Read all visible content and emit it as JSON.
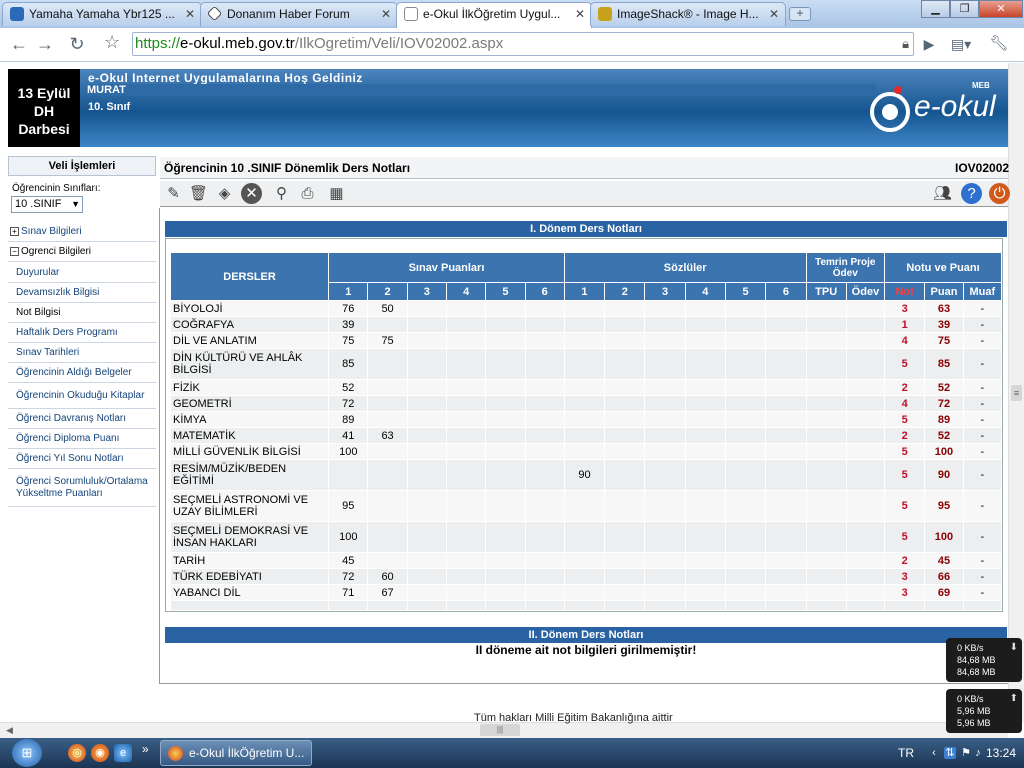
{
  "browser": {
    "tabs": [
      {
        "title": "Yamaha Yamaha Ybr125 ...",
        "icon": "page-icon"
      },
      {
        "title": "Donanım Haber Forum",
        "icon": "forum-icon"
      },
      {
        "title": "e-Okul İlkÖğretim Uygul...",
        "icon": "page-icon"
      },
      {
        "title": "ImageShack® - Image H...",
        "icon": "frog-icon"
      }
    ],
    "url_scheme": "https://",
    "url_host": "e-okul.meb.gov.tr",
    "url_path": "/IlkOgretim/Veli/IOV02002.aspx"
  },
  "header": {
    "date_box": [
      "13 Eylül",
      "DH",
      "Darbesi"
    ],
    "welcome": "e-Okul Internet Uygulamalarına Hoş Geldiniz",
    "student_name": "MURAT",
    "class_label": "10. Sınıf",
    "logo_small": "MEB",
    "logo_text": "e-okul"
  },
  "sidebar": {
    "title": "Veli İşlemleri",
    "class_select_label": "Öğrencinin Sınıfları:",
    "class_select_value": "10 .SINIF",
    "sections": [
      {
        "label": "Sınav Bilgileri",
        "expanded": false
      },
      {
        "label": "Ogrenci Bilgileri",
        "expanded": true
      }
    ],
    "items": [
      "Duyurular",
      "Devamsızlık Bilgisi",
      "Not Bilgisi",
      "Haftalık Ders Programı",
      "Sınav Tarihleri",
      "Öğrencinin Aldığı Belgeler",
      "Öğrencinin Okuduğu Kitaplar",
      "Öğrenci Davranış Notları",
      "Öğrenci Diploma Puanı",
      "Öğrenci Yıl Sonu Notları",
      "Öğrenci Sorumluluk/Ortalama Yükseltme Puanları"
    ]
  },
  "panel": {
    "title": "Öğrencinin  10 .SINIF  Dönemlik Ders Notları",
    "code": "IOV02002"
  },
  "sem1": {
    "title": "I. Dönem Ders Notları",
    "headers": {
      "dersler": "DERSLER",
      "sinav": "Sınav Puanları",
      "sozlu": "Sözlüler",
      "temrin": "Temrin Proje Ödev",
      "notu": "Notu ve Puanı",
      "tpu": "TPU",
      "odev": "Ödev",
      "not": "Not",
      "puan": "Puan",
      "muaf": "Muaf",
      "nums": [
        "1",
        "2",
        "3",
        "4",
        "5",
        "6"
      ]
    },
    "rows": [
      {
        "ders": "BİYOLOJİ",
        "s": [
          "76",
          "50",
          "",
          "",
          "",
          ""
        ],
        "z": [
          "",
          "",
          "",
          "",
          "",
          ""
        ],
        "not": "3",
        "puan": "63",
        "muaf": "-"
      },
      {
        "ders": "COĞRAFYA",
        "s": [
          "39",
          "",
          "",
          "",
          "",
          ""
        ],
        "z": [
          "",
          "",
          "",
          "",
          "",
          ""
        ],
        "not": "1",
        "puan": "39",
        "muaf": "-"
      },
      {
        "ders": "DİL VE ANLATIM",
        "s": [
          "75",
          "75",
          "",
          "",
          "",
          ""
        ],
        "z": [
          "",
          "",
          "",
          "",
          "",
          ""
        ],
        "not": "4",
        "puan": "75",
        "muaf": "-"
      },
      {
        "ders": "DİN KÜLTÜRÜ VE AHLÂK BİLGİSİ",
        "s": [
          "85",
          "",
          "",
          "",
          "",
          ""
        ],
        "z": [
          "",
          "",
          "",
          "",
          "",
          ""
        ],
        "not": "5",
        "puan": "85",
        "muaf": "-"
      },
      {
        "ders": "FİZİK",
        "s": [
          "52",
          "",
          "",
          "",
          "",
          ""
        ],
        "z": [
          "",
          "",
          "",
          "",
          "",
          ""
        ],
        "not": "2",
        "puan": "52",
        "muaf": "-"
      },
      {
        "ders": "GEOMETRİ",
        "s": [
          "72",
          "",
          "",
          "",
          "",
          ""
        ],
        "z": [
          "",
          "",
          "",
          "",
          "",
          ""
        ],
        "not": "4",
        "puan": "72",
        "muaf": "-"
      },
      {
        "ders": "KİMYA",
        "s": [
          "89",
          "",
          "",
          "",
          "",
          ""
        ],
        "z": [
          "",
          "",
          "",
          "",
          "",
          ""
        ],
        "not": "5",
        "puan": "89",
        "muaf": "-"
      },
      {
        "ders": "MATEMATİK",
        "s": [
          "41",
          "63",
          "",
          "",
          "",
          ""
        ],
        "z": [
          "",
          "",
          "",
          "",
          "",
          ""
        ],
        "not": "2",
        "puan": "52",
        "muaf": "-"
      },
      {
        "ders": "MİLLİ GÜVENLİK BİLGİSİ",
        "s": [
          "100",
          "",
          "",
          "",
          "",
          ""
        ],
        "z": [
          "",
          "",
          "",
          "",
          "",
          ""
        ],
        "not": "5",
        "puan": "100",
        "muaf": "-"
      },
      {
        "ders": "RESİM/MÜZİK/BEDEN EĞİTİMİ",
        "s": [
          "",
          "",
          "",
          "",
          "",
          ""
        ],
        "z": [
          "90",
          "",
          "",
          "",
          "",
          ""
        ],
        "not": "5",
        "puan": "90",
        "muaf": "-"
      },
      {
        "ders": "SEÇMELİ ASTRONOMİ VE UZAY BİLİMLERİ",
        "s": [
          "95",
          "",
          "",
          "",
          "",
          ""
        ],
        "z": [
          "",
          "",
          "",
          "",
          "",
          ""
        ],
        "not": "5",
        "puan": "95",
        "muaf": "-"
      },
      {
        "ders": "SEÇMELİ DEMOKRASİ VE İNSAN HAKLARI",
        "s": [
          "100",
          "",
          "",
          "",
          "",
          ""
        ],
        "z": [
          "",
          "",
          "",
          "",
          "",
          ""
        ],
        "not": "5",
        "puan": "100",
        "muaf": "-"
      },
      {
        "ders": "TARİH",
        "s": [
          "45",
          "",
          "",
          "",
          "",
          ""
        ],
        "z": [
          "",
          "",
          "",
          "",
          "",
          ""
        ],
        "not": "2",
        "puan": "45",
        "muaf": "-"
      },
      {
        "ders": "TÜRK EDEBİYATI",
        "s": [
          "72",
          "60",
          "",
          "",
          "",
          ""
        ],
        "z": [
          "",
          "",
          "",
          "",
          "",
          ""
        ],
        "not": "3",
        "puan": "66",
        "muaf": "-"
      },
      {
        "ders": "YABANCI DİL",
        "s": [
          "71",
          "67",
          "",
          "",
          "",
          ""
        ],
        "z": [
          "",
          "",
          "",
          "",
          "",
          ""
        ],
        "not": "3",
        "puan": "69",
        "muaf": "-"
      }
    ]
  },
  "sem2": {
    "title": "II. Dönem Ders Notları",
    "message": "II döneme ait not bilgileri girilmemiştir!"
  },
  "footer": "Tüm hakları Milli Eğitim Bakanlığına aittir",
  "net_widget": [
    {
      "speed": "0 KB/s",
      "l1": "84,68 MB",
      "l2": "84,68 MB",
      "dir": "down-arrow-icon"
    },
    {
      "speed": "0 KB/s",
      "l1": "5,96 MB",
      "l2": "5,96 MB",
      "dir": "up-arrow-icon"
    }
  ],
  "taskbar": {
    "task_title": "e-Okul İlkÖğretim U...",
    "lang": "TR",
    "clock": "13:24"
  }
}
